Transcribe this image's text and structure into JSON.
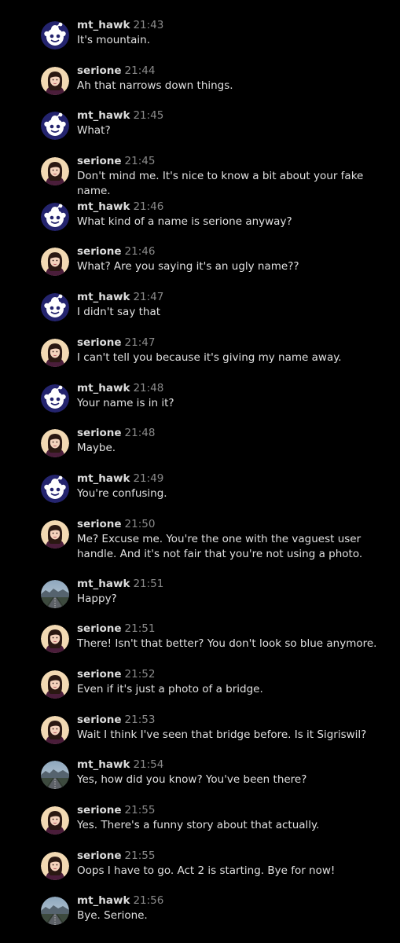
{
  "messages": [
    {
      "user": "mt_hawk",
      "time": "21:43",
      "text": "It's mountain.",
      "avatar": "snoo-icon"
    },
    {
      "user": "serione",
      "time": "21:44",
      "text": "Ah that narrows down things.",
      "avatar": "woman-photo"
    },
    {
      "user": "mt_hawk",
      "time": "21:45",
      "text": "What?",
      "avatar": "snoo-icon"
    },
    {
      "user": "serione",
      "time": "21:45",
      "text": "Don't mind me. It's nice to know a bit about your fake name.",
      "avatar": "woman-photo"
    },
    {
      "user": "mt_hawk",
      "time": "21:46",
      "text": "What kind of a name is serione anyway?",
      "avatar": "snoo-icon"
    },
    {
      "user": "serione",
      "time": "21:46",
      "text": "What? Are you saying it's an ugly name??",
      "avatar": "woman-photo"
    },
    {
      "user": "mt_hawk",
      "time": "21:47",
      "text": "I didn't say that",
      "avatar": "snoo-icon"
    },
    {
      "user": "serione",
      "time": "21:47",
      "text": "I can't tell you because it's giving my name away.",
      "avatar": "woman-photo"
    },
    {
      "user": "mt_hawk",
      "time": "21:48",
      "text": "Your name is in it?",
      "avatar": "snoo-icon"
    },
    {
      "user": "serione",
      "time": "21:48",
      "text": "Maybe.",
      "avatar": "woman-photo"
    },
    {
      "user": "mt_hawk",
      "time": "21:49",
      "text": "You're confusing.",
      "avatar": "snoo-icon"
    },
    {
      "user": "serione",
      "time": "21:50",
      "text": "Me? Excuse me. You're the one with the vaguest user handle. And it's not fair that you're not using a photo.",
      "avatar": "woman-photo",
      "multiline": true
    },
    {
      "user": "mt_hawk",
      "time": "21:51",
      "text": "Happy?",
      "avatar": "bridge-photo"
    },
    {
      "user": "serione",
      "time": "21:51",
      "text": "There! Isn't that better? You don't look so blue anymore.",
      "avatar": "woman-photo"
    },
    {
      "user": "serione",
      "time": "21:52",
      "text": "Even if it's just a photo of a bridge.",
      "avatar": "woman-photo"
    },
    {
      "user": "serione",
      "time": "21:53",
      "text": "Wait I think I've seen that bridge before. Is it Sigriswil?",
      "avatar": "woman-photo"
    },
    {
      "user": "mt_hawk",
      "time": "21:54",
      "text": "Yes, how did you know? You've been there?",
      "avatar": "bridge-photo"
    },
    {
      "user": "serione",
      "time": "21:55",
      "text": "Yes. There's a funny story about that actually.",
      "avatar": "woman-photo"
    },
    {
      "user": "serione",
      "time": "21:55",
      "text": "Oops I have to go. Act 2 is starting. Bye for now!",
      "avatar": "woman-photo"
    },
    {
      "user": "mt_hawk",
      "time": "21:56",
      "text": "Bye. Serione.",
      "avatar": "bridge-photo"
    }
  ],
  "colors": {
    "background": "#000000",
    "username": "#dcdcdc",
    "timestamp": "#8a8a8a",
    "message_text": "#e0e0e0",
    "snoo_bg": "#24246e",
    "woman_bg": "#f2d9b3"
  }
}
